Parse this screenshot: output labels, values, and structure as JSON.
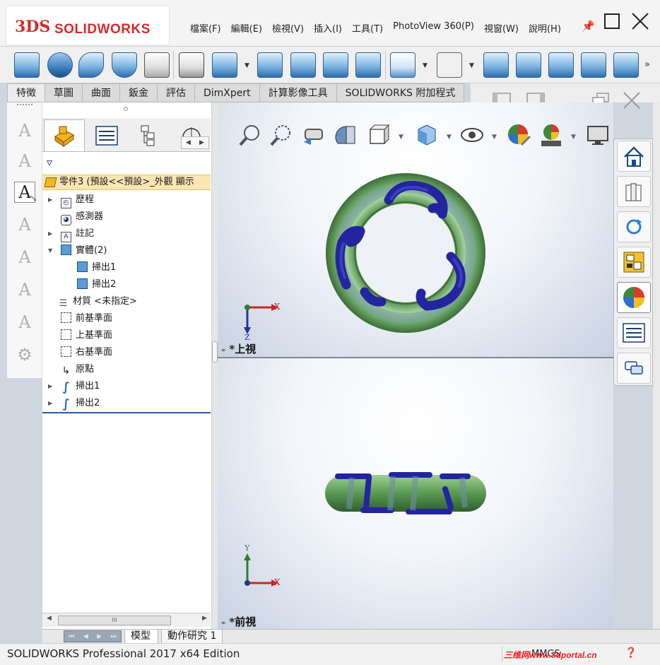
{
  "app": {
    "logo_mark": "3DS",
    "brand": "SOLIDWORKS"
  },
  "menu": [
    "檔案(F)",
    "編輯(E)",
    "檢視(V)",
    "插入(I)",
    "工具(T)",
    "PhotoView 360(P)",
    "視窗(W)",
    "說明(H)"
  ],
  "command_tabs": [
    "特徵",
    "草圖",
    "曲面",
    "鈑金",
    "評估",
    "DimXpert",
    "計算影像工具",
    "SOLIDWORKS 附加程式"
  ],
  "command_icons": [
    "extruded-boss-icon",
    "revolved-boss-icon",
    "swept-boss-icon",
    "lofted-boss-icon",
    "boundary-boss-icon",
    "extruded-cut-icon",
    "hole-wizard-icon",
    "revolved-cut-icon",
    "swept-cut-icon",
    "lofted-cut-icon",
    "boundary-cut-icon",
    "fillet-icon",
    "linear-pattern-icon",
    "rib-icon",
    "draft-icon",
    "shell-icon",
    "wrap-icon",
    "intersect-icon",
    "reference-geometry-icon",
    "curves-icon"
  ],
  "feature_tree": {
    "part_label": "零件3  (預設<<預設>_外觀 顯示",
    "items": [
      {
        "label": "歷程",
        "icon": "history-icon",
        "expand": true
      },
      {
        "label": "感測器",
        "icon": "sensor-icon",
        "expand": false
      },
      {
        "label": "註記",
        "icon": "annotations-icon",
        "expand": true
      },
      {
        "label": "實體(2)",
        "icon": "solid-bodies-icon",
        "expand": true,
        "expanded": true
      },
      {
        "label": "掃出1",
        "icon": "body-icon",
        "child": true
      },
      {
        "label": "掃出2",
        "icon": "body-icon",
        "child": true
      },
      {
        "label": "材質 <未指定>",
        "icon": "material-icon",
        "expand": false
      },
      {
        "label": "前基準面",
        "icon": "plane-icon",
        "expand": false
      },
      {
        "label": "上基準面",
        "icon": "plane-icon",
        "expand": false
      },
      {
        "label": "右基準面",
        "icon": "plane-icon",
        "expand": false
      },
      {
        "label": "原點",
        "icon": "origin-icon",
        "expand": false
      },
      {
        "label": "掃出1",
        "icon": "sweep-feature-icon",
        "expand": true
      },
      {
        "label": "掃出2",
        "icon": "sweep-feature-icon",
        "expand": true
      }
    ],
    "scroll_thumb": "III"
  },
  "viewports": {
    "top_label": "*上視",
    "front_label": "*前視",
    "axis_x": "X",
    "axis_y": "Y",
    "axis_z": "Z"
  },
  "bottom_tabs": [
    "模型",
    "動作研究 1"
  ],
  "status": {
    "text": "SOLIDWORKS Professional 2017 x64 Edition",
    "units": "MMGS"
  },
  "watermark": "三维网www.3dportal.cn",
  "colors": {
    "torus": "#5f9f5a",
    "sweep": "#2a2aa8",
    "accent": "#d52a2a"
  }
}
